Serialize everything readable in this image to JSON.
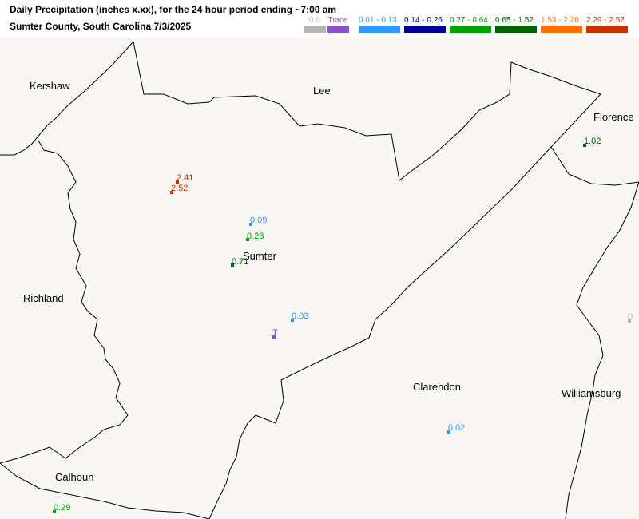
{
  "header": {
    "title": "Daily Precipitation (inches  x.xx),  for the 24 hour period ending ~7:00 am",
    "subtitle": "Sumter County, South Carolina  7/3/2025"
  },
  "legend": [
    {
      "label": "0.0",
      "color": "#b4b4b4"
    },
    {
      "label": "Trace",
      "color": "#8c50c8"
    },
    {
      "label": "0.01 - 0.13",
      "color": "#3296ff"
    },
    {
      "label": "0.14 - 0.26",
      "color": "#000096"
    },
    {
      "label": "0.27 - 0.64",
      "color": "#00a000"
    },
    {
      "label": "0.65 - 1.52",
      "color": "#006400"
    },
    {
      "label": "1.53 - 2.28",
      "color": "#ff7000"
    },
    {
      "label": "2.29 - 2.52",
      "color": "#c83200"
    }
  ],
  "counties": {
    "kershaw": "Kershaw",
    "lee": "Lee",
    "florence": "Florence",
    "sumter": "Sumter",
    "richland": "Richland",
    "clarendon": "Clarendon",
    "williamsburg": "Williamsburg",
    "calhoun": "Calhoun"
  },
  "stations": [
    {
      "label": "2.41",
      "color": "#c83200"
    },
    {
      "label": "2.52",
      "color": "#c83200"
    },
    {
      "label": "0.09",
      "color": "#3296ff"
    },
    {
      "label": "0.28",
      "color": "#00a000"
    },
    {
      "label": "0.71",
      "color": "#006400"
    },
    {
      "label": "0.03",
      "color": "#3296ff"
    },
    {
      "label": "T",
      "color": "#8c50c8"
    },
    {
      "label": "1.02",
      "color": "#006400"
    },
    {
      "label": "0.02",
      "color": "#3296ff"
    },
    {
      "label": "0.29",
      "color": "#00a000"
    },
    {
      "label": "0",
      "color": "#b4b4b4"
    }
  ]
}
